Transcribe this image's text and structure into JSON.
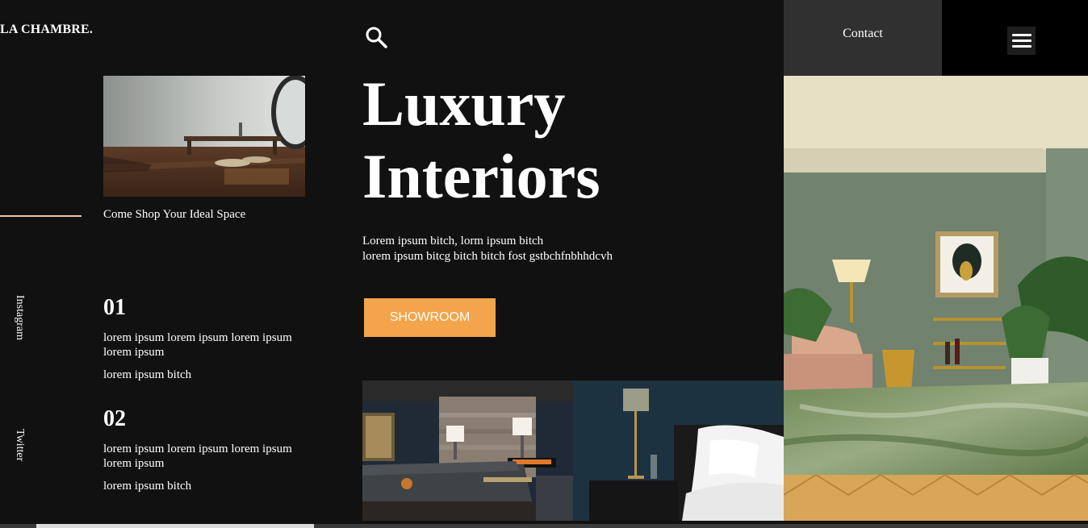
{
  "header": {
    "logo": "LA CHAMBRE.",
    "contact": "Contact",
    "search_icon": "search-icon",
    "menu_icon": "hamburger-menu-icon"
  },
  "social": {
    "instagram": "Instagram",
    "twitter": "Twitter"
  },
  "feature": {
    "caption": "Come Shop Your Ideal Space"
  },
  "items": [
    {
      "number": "01",
      "line1": "lorem ipsum lorem ipsum lorem ipsum lorem ipsum",
      "line2": "lorem ipsum bitch"
    },
    {
      "number": "02",
      "line1": "lorem ipsum lorem ipsum lorem ipsum lorem ipsum",
      "line2": "lorem ipsum bitch"
    }
  ],
  "hero": {
    "title_line1": "Luxury",
    "title_line2": "Interiors",
    "desc_line1": "Lorem ipsum bitch, lorm ipsum bitch",
    "desc_line2": "lorem ipsum bitcg bitch bitch fost gstbchfnbhhdcvh",
    "cta": "SHOWROOM"
  },
  "colors": {
    "background": "#111111",
    "accent": "#f4a44a",
    "contact_bg": "#303030",
    "divider": "#e8c7a4"
  }
}
